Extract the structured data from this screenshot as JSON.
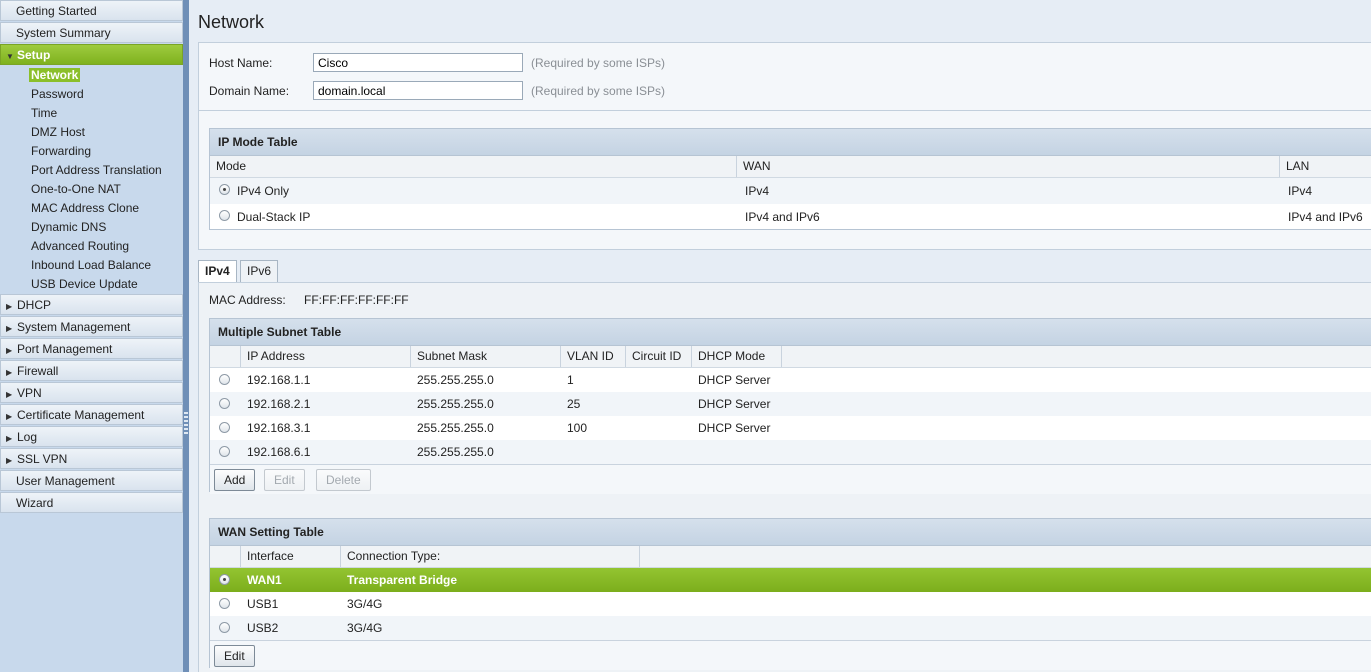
{
  "sidebar": {
    "top_before": [
      "Getting Started",
      "System Summary"
    ],
    "active_section": "Setup",
    "sub_items": [
      "Network",
      "Password",
      "Time",
      "DMZ Host",
      "Forwarding",
      "Port Address Translation",
      "One-to-One NAT",
      "MAC Address Clone",
      "Dynamic DNS",
      "Advanced Routing",
      "Inbound Load Balance",
      "USB Device Update"
    ],
    "selected_sub": "Network",
    "top_after": [
      "DHCP",
      "System Management",
      "Port Management",
      "Firewall",
      "VPN",
      "Certificate Management",
      "Log",
      "SSL VPN",
      "User Management",
      "Wizard"
    ]
  },
  "page": {
    "title": "Network"
  },
  "host": {
    "host_label": "Host Name:",
    "host_value": "Cisco",
    "host_hint": "(Required by some ISPs)",
    "domain_label": "Domain Name:",
    "domain_value": "domain.local",
    "domain_hint": "(Required by some ISPs)"
  },
  "ip_mode": {
    "title": "IP Mode Table",
    "headers": [
      "Mode",
      "WAN",
      "LAN"
    ],
    "rows": [
      {
        "mode": "IPv4 Only",
        "wan": "IPv4",
        "lan": "IPv4",
        "selected": true
      },
      {
        "mode": "Dual-Stack IP",
        "wan": "IPv4 and IPv6",
        "lan": "IPv4 and IPv6",
        "selected": false
      }
    ]
  },
  "tabs": {
    "ipv4": "IPv4",
    "ipv6": "IPv6",
    "selected": "IPv4"
  },
  "mac": {
    "label": "MAC Address:",
    "value": "FF:FF:FF:FF:FF:FF"
  },
  "subnet": {
    "title": "Multiple Subnet Table",
    "headers": [
      "IP Address",
      "Subnet Mask",
      "VLAN ID",
      "Circuit ID",
      "DHCP Mode"
    ],
    "rows": [
      {
        "ip": "192.168.1.1",
        "mask": "255.255.255.0",
        "vlan": "1",
        "circuit": "",
        "dhcp": "DHCP Server"
      },
      {
        "ip": "192.168.2.1",
        "mask": "255.255.255.0",
        "vlan": "25",
        "circuit": "",
        "dhcp": "DHCP Server"
      },
      {
        "ip": "192.168.3.1",
        "mask": "255.255.255.0",
        "vlan": "100",
        "circuit": "",
        "dhcp": "DHCP Server"
      },
      {
        "ip": "192.168.6.1",
        "mask": "255.255.255.0",
        "vlan": "",
        "circuit": "",
        "dhcp": ""
      }
    ],
    "buttons": {
      "add": "Add",
      "edit": "Edit",
      "delete": "Delete"
    }
  },
  "wan": {
    "title": "WAN Setting Table",
    "headers": [
      "Interface",
      "Connection Type:"
    ],
    "rows": [
      {
        "iface": "WAN1",
        "type": "Transparent Bridge",
        "selected": true
      },
      {
        "iface": "USB1",
        "type": "3G/4G",
        "selected": false
      },
      {
        "iface": "USB2",
        "type": "3G/4G",
        "selected": false
      }
    ],
    "buttons": {
      "edit": "Edit"
    }
  },
  "colors": {
    "accent_green": "#8bbf2a",
    "sidebar_bg": "#c8d9ec",
    "splitter": "#6f8fb7"
  }
}
